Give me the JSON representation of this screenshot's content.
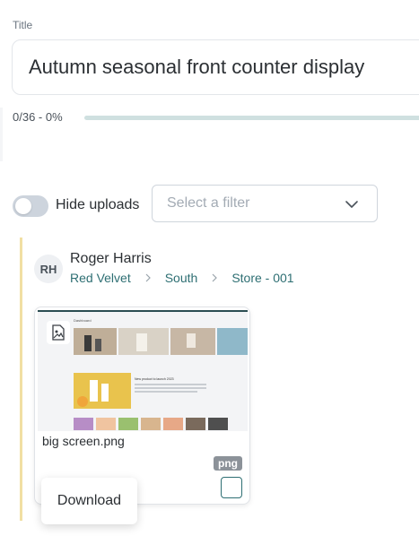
{
  "title": {
    "label": "Title",
    "value": "Autumn seasonal front counter display"
  },
  "progress": {
    "text": "0/36 - 0%",
    "fraction": 0.0
  },
  "controls": {
    "hide_uploads_label": "Hide uploads",
    "hide_uploads_on": false,
    "filter_placeholder": "Select a filter"
  },
  "upload": {
    "avatar_initials": "RH",
    "user_name": "Roger Harris",
    "breadcrumb": [
      "Red Velvet",
      "South",
      "Store - 001"
    ],
    "file": {
      "name": "big screen.png",
      "type_badge": "png",
      "preview_heading": "Dashboard",
      "preview_feature_title": "New product to launch 2023"
    }
  },
  "menu": {
    "download_label": "Download"
  },
  "colors": {
    "accent": "#2e6f73",
    "progress_track": "#cfe0e0",
    "upload_rule": "#f1dfa3",
    "toggle_off": "#cdd4dd"
  }
}
